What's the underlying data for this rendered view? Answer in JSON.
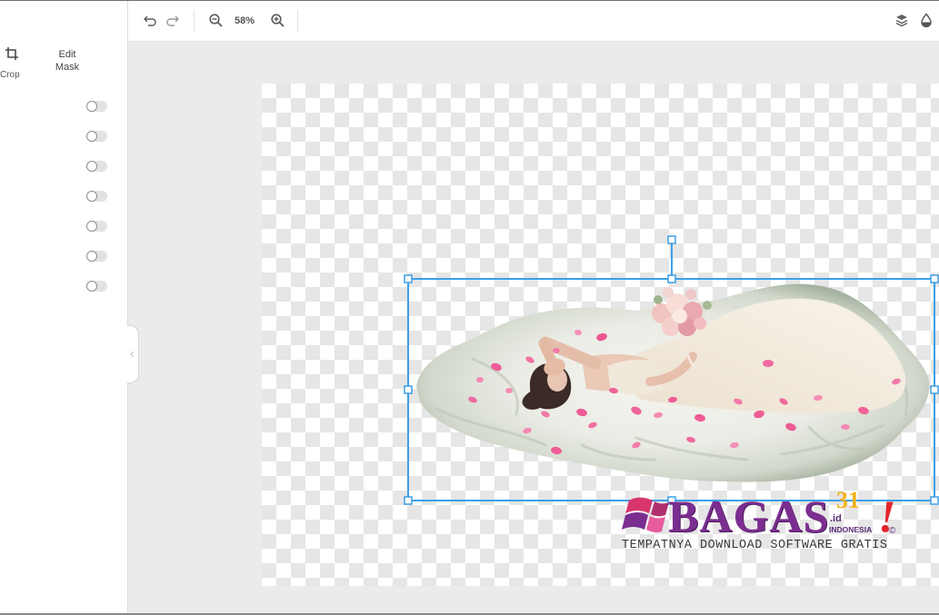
{
  "sidebar": {
    "crop_label": "Crop",
    "edit_mask_label": "Edit Mask",
    "toggles": [
      false,
      false,
      false,
      false,
      false,
      false,
      false
    ]
  },
  "toolbar": {
    "zoom_level": "58%",
    "icons": [
      "undo-icon",
      "redo-icon",
      "zoom-out-icon",
      "zoom-in-icon",
      "layers-icon",
      "drop-icon"
    ]
  },
  "watermark": {
    "brand": "BAGAS",
    "number": "31",
    "tld": ".id",
    "country": "INDONESIA",
    "mark": "!",
    "copyright": "©",
    "tagline": "TEMPATNYA DOWNLOAD SOFTWARE GRATIS"
  },
  "colors": {
    "accent": "#3d9fe6",
    "canvas_background": "#ebebeb",
    "checker": "#e6e6e6",
    "watermark_brand": "#7b2e90",
    "watermark_number": "#f2b21e",
    "watermark_mark": "#e3252b"
  }
}
